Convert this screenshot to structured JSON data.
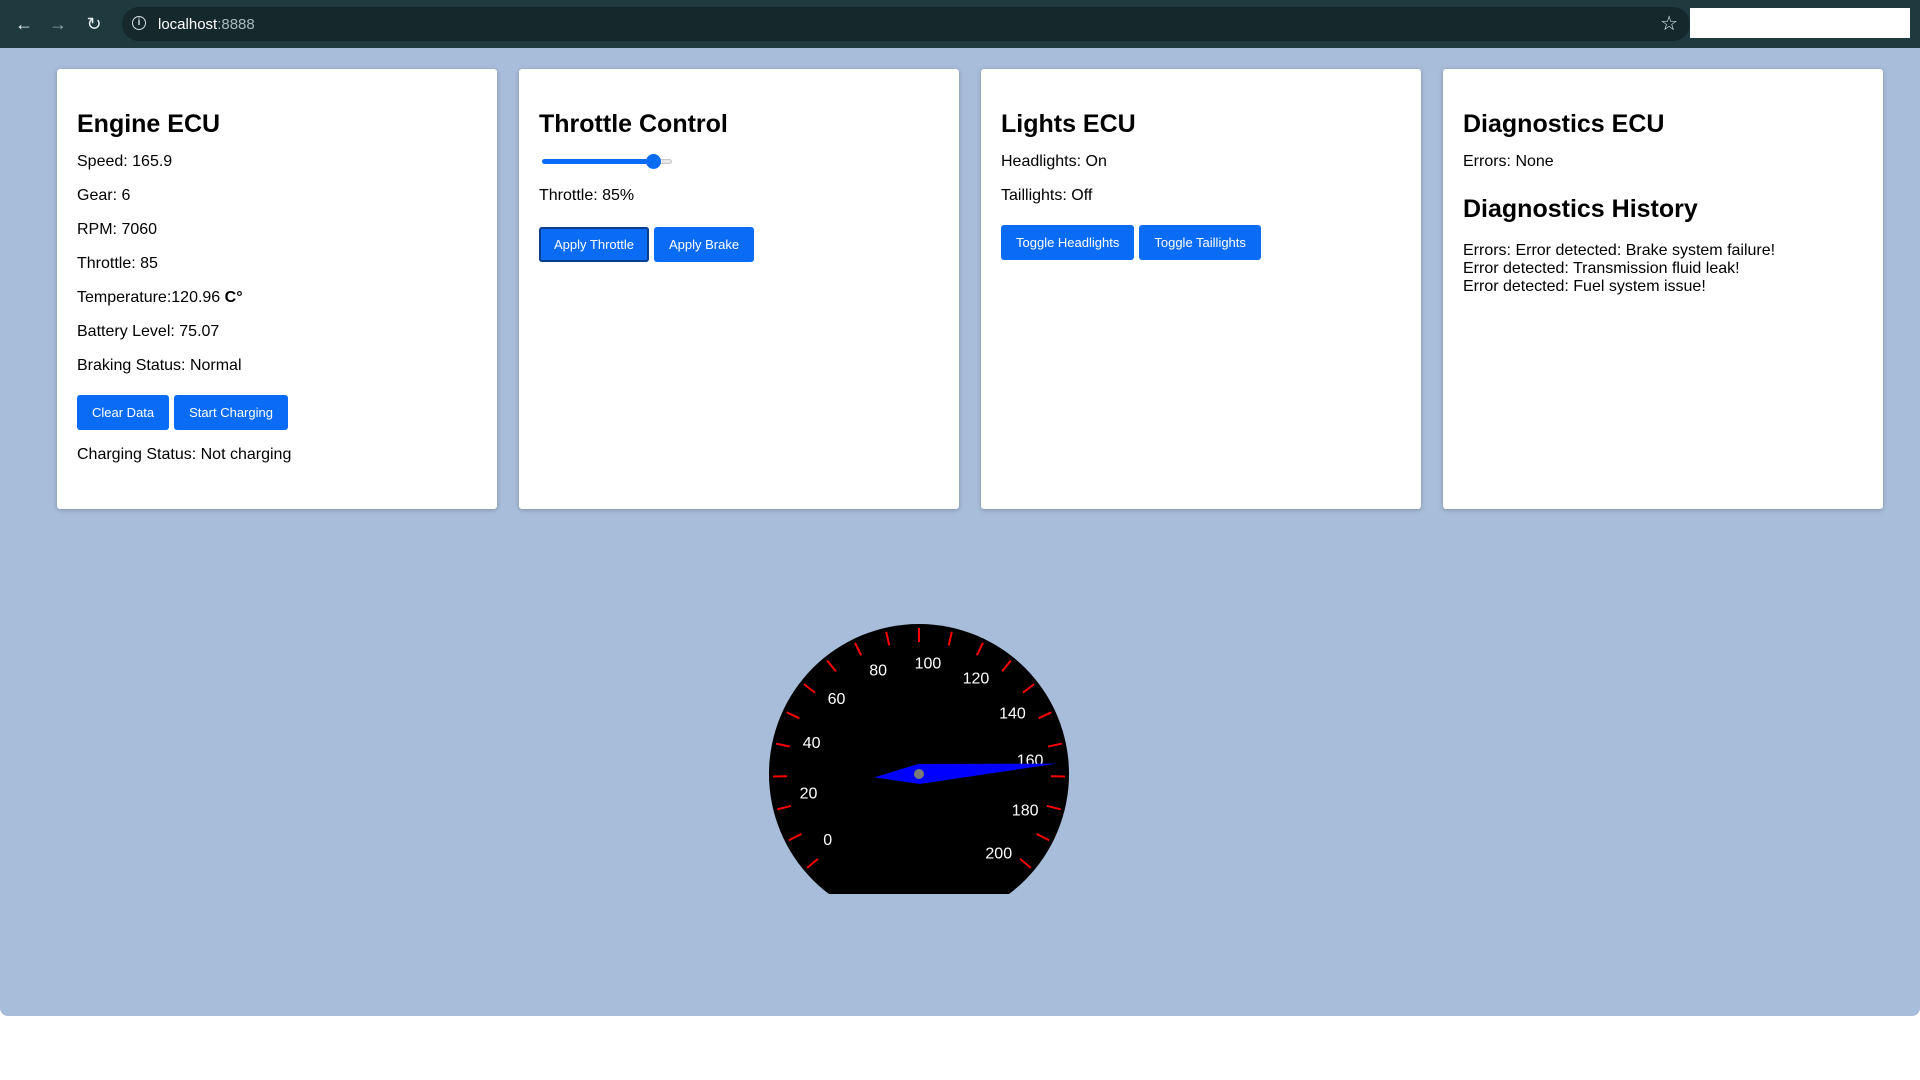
{
  "browser": {
    "url_host": "localhost",
    "url_port": ":8888"
  },
  "engine": {
    "title": "Engine ECU",
    "speed": "Speed: 165.9",
    "gear": "Gear: 6",
    "rpm": "RPM: 7060",
    "throttle": "Throttle: 85",
    "temperature_label": "Temperature:120.96",
    "temperature_unit": "C°",
    "battery": "Battery Level: 75.07",
    "braking": "Braking Status: Normal",
    "clear_label": "Clear Data",
    "charging_label": "Start Charging",
    "charging_status": "Charging Status: Not charging"
  },
  "throttle_control": {
    "title": "Throttle Control",
    "slider_value": 85,
    "slider_fraction": 0.85,
    "throttle_text": "Throttle: 85%",
    "apply_throttle_label": "Apply Throttle",
    "apply_brake_label": "Apply Brake"
  },
  "lights": {
    "title": "Lights ECU",
    "headlights": "Headlights: On",
    "taillights": "Taillights: Off",
    "toggle_headlights_label": "Toggle Headlights",
    "toggle_taillights_label": "Toggle Taillights"
  },
  "diagnostics": {
    "title": "Diagnostics ECU",
    "errors": "Errors: None",
    "history_title": "Diagnostics History",
    "history": [
      "Errors: Error detected: Brake system failure!",
      "Error detected: Transmission fluid leak!",
      "Error detected: Fuel system issue!"
    ]
  },
  "speedometer": {
    "labels": [
      "0",
      "20",
      "40",
      "60",
      "80",
      "100",
      "120",
      "140",
      "160",
      "180",
      "200"
    ],
    "min": 0,
    "max": 200,
    "value": 165.9
  },
  "colors": {
    "page_bg": "#a8bdda",
    "accent": "#0a6cf5",
    "toolbar": "#1e3a3f",
    "gauge_face": "#000000",
    "gauge_ticks": "#ff0000",
    "needle": "#0000ff"
  }
}
